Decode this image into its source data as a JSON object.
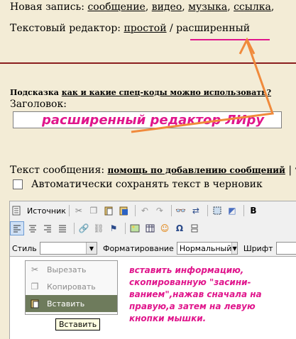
{
  "header": {
    "new_post_label": "Новая запись:",
    "links": [
      "сообщение",
      "видео",
      "музыка",
      "ссылка"
    ],
    "cut": ","
  },
  "editor_mode": {
    "label": "Текстовый редактор:",
    "simple": "простой",
    "separator": "/",
    "advanced": "расширенный"
  },
  "hint": {
    "prefix": "Подсказка",
    "link": "как и какие спец-коды можно использовать?"
  },
  "title_field": {
    "label": "Заголовок:",
    "value": "расширенный редактор ЛИру"
  },
  "message": {
    "label": "Текст сообщения:",
    "help_link": "помощь по добавлению сообщений",
    "extra": "| т"
  },
  "autosave_label": "Автоматически сохранять текст в черновик",
  "toolbar": {
    "source_label": "Источник",
    "style_label": "Стиль",
    "style_value": "",
    "format_label": "Форматирование",
    "format_value": "Нормальный",
    "font_label": "Шрифт"
  },
  "context_menu": {
    "items": [
      {
        "label": "Вырезать",
        "icon": "scissors-icon"
      },
      {
        "label": "Копировать",
        "icon": "copy-icon"
      },
      {
        "label": "Вставить",
        "icon": "paste-icon"
      }
    ],
    "tooltip": "Вставить"
  },
  "annotation": "вставить информацию,\nскопированную \"засини-\nванием\",нажав сначала на\nправую,а затем на левую\nкнопки  мышки.",
  "colors": {
    "accent_pink": "#e0168c",
    "arrow_orange": "#f08a3c",
    "page_bg": "#f3ecd6",
    "divider": "#8a1e1e"
  }
}
